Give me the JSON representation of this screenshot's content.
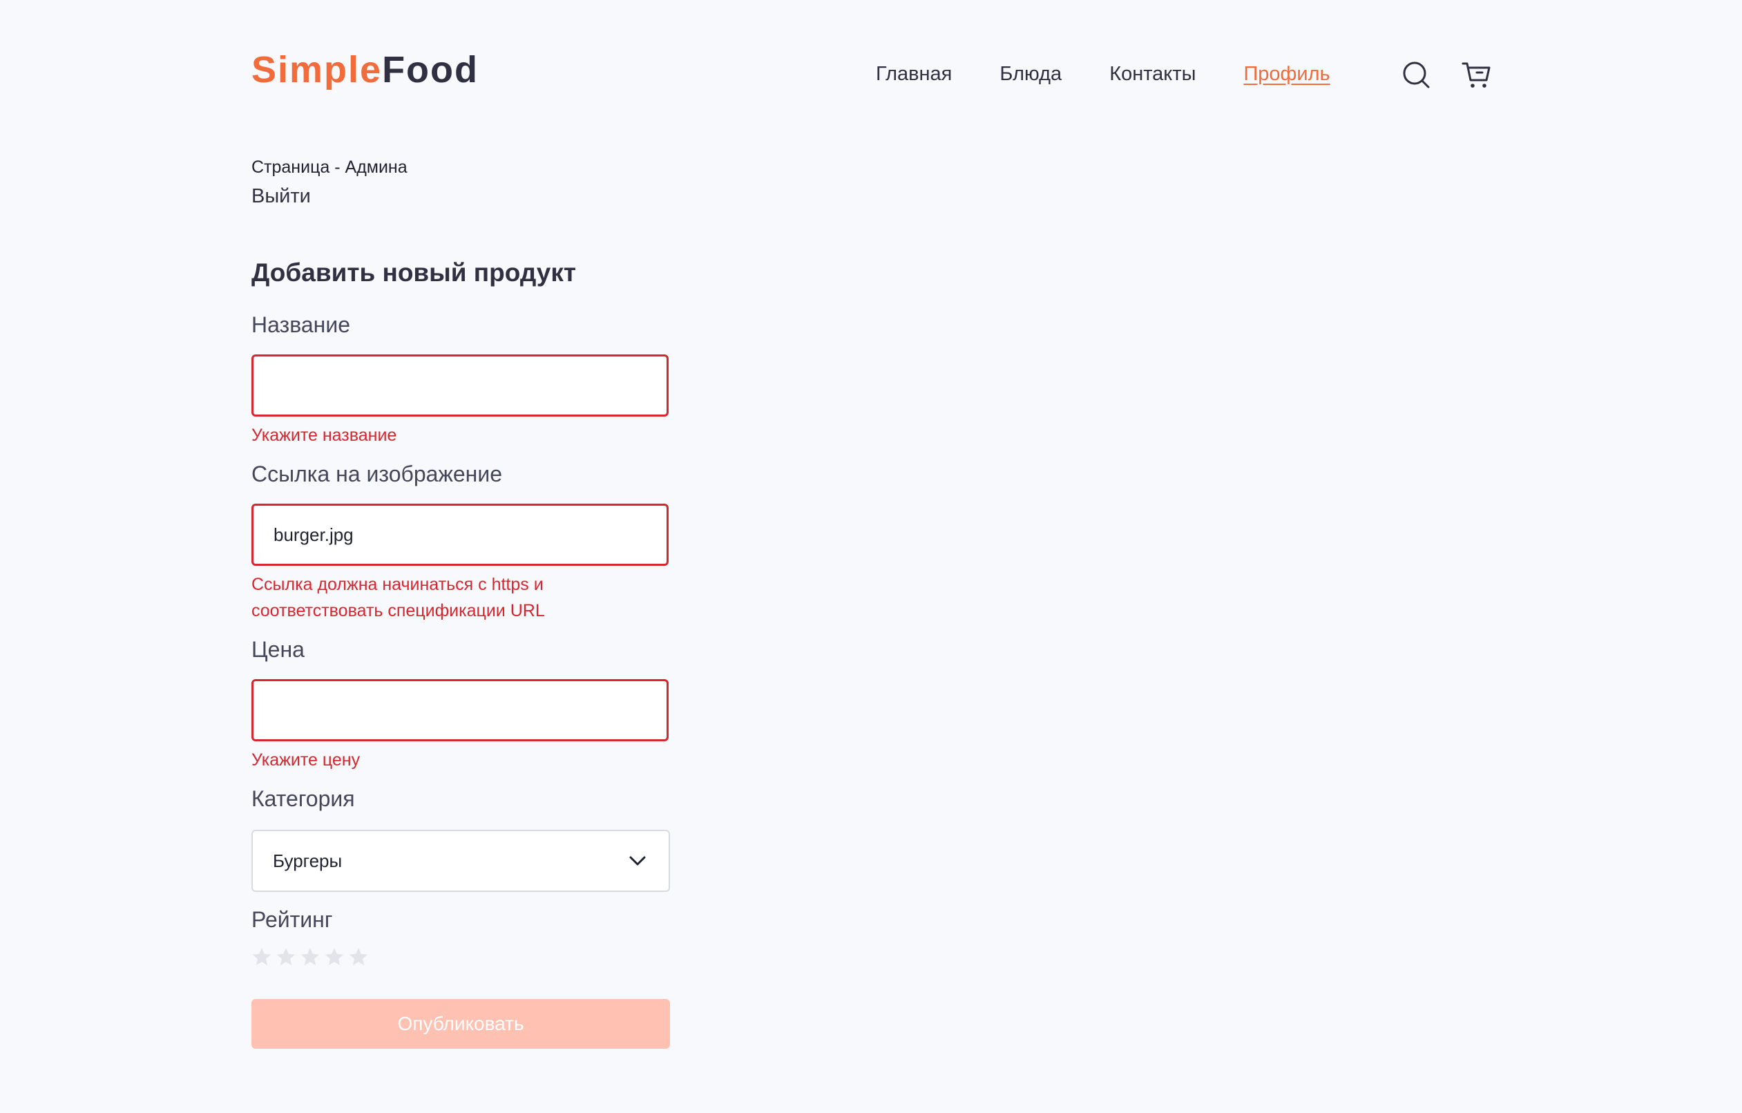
{
  "header": {
    "logo_part_1": "Simple",
    "logo_part_2": "Food",
    "nav": [
      {
        "label": "Главная"
      },
      {
        "label": "Блюда"
      },
      {
        "label": "Контакты"
      },
      {
        "label": "Профиль",
        "active": true
      }
    ],
    "icons": [
      "search-icon",
      "cart-icon"
    ]
  },
  "admin": {
    "title": "Страница - Админа",
    "logout_label": "Выйти"
  },
  "form": {
    "title": "Добавить новый продукт",
    "name": {
      "label": "Название",
      "value": "",
      "error": "Укажите название"
    },
    "image": {
      "label": "Ссылка на изображение",
      "value": "burger.jpg",
      "error": "Ссылка должна начинаться с https и соответствовать спецификации URL"
    },
    "price": {
      "label": "Цена",
      "value": "",
      "error": "Укажите цену"
    },
    "category": {
      "label": "Категория",
      "selected": "Бургеры"
    },
    "rating": {
      "label": "Рейтинг",
      "value": 0,
      "max": 5
    },
    "submit_label": "Опубликовать"
  },
  "colors": {
    "accent": "#f26b3a",
    "error": "#d8262e",
    "text": "#2f3142",
    "disabled_button": "#ffc1b2",
    "star_empty": "#e3e4ea",
    "background": "#f8f9fd"
  }
}
